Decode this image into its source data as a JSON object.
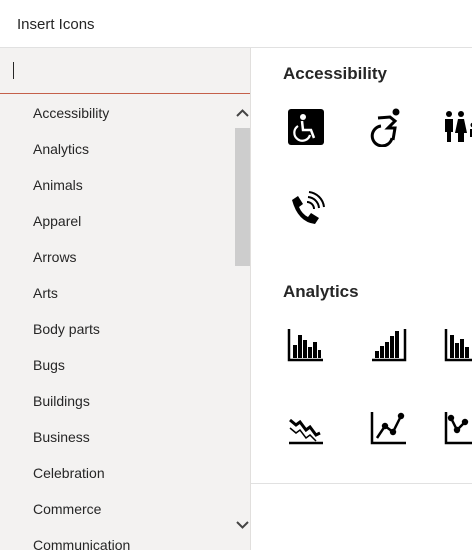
{
  "dialog": {
    "title": "Insert Icons"
  },
  "search": {
    "value": "",
    "placeholder": ""
  },
  "categories": [
    "Accessibility",
    "Analytics",
    "Animals",
    "Apparel",
    "Arrows",
    "Arts",
    "Body parts",
    "Bugs",
    "Buildings",
    "Business",
    "Celebration",
    "Commerce",
    "Communication"
  ],
  "sections": [
    {
      "title": "Accessibility",
      "icons": [
        "wheelchair-sign-icon",
        "active-wheelchair-icon",
        "family-restroom-icon",
        "tty-phone-icon"
      ]
    },
    {
      "title": "Analytics",
      "icons": [
        "bar-chart-baseline-icon",
        "bar-chart-rising-icon",
        "bar-chart-partial-icon",
        "line-chart-down-icon",
        "line-chart-up-icon",
        "line-chart-partial-icon"
      ]
    }
  ],
  "colors": {
    "accent": "#c4604a",
    "sidebar_bg": "#f3f2f1",
    "scroll_thumb": "#cdcdcd",
    "text": "#262626"
  }
}
